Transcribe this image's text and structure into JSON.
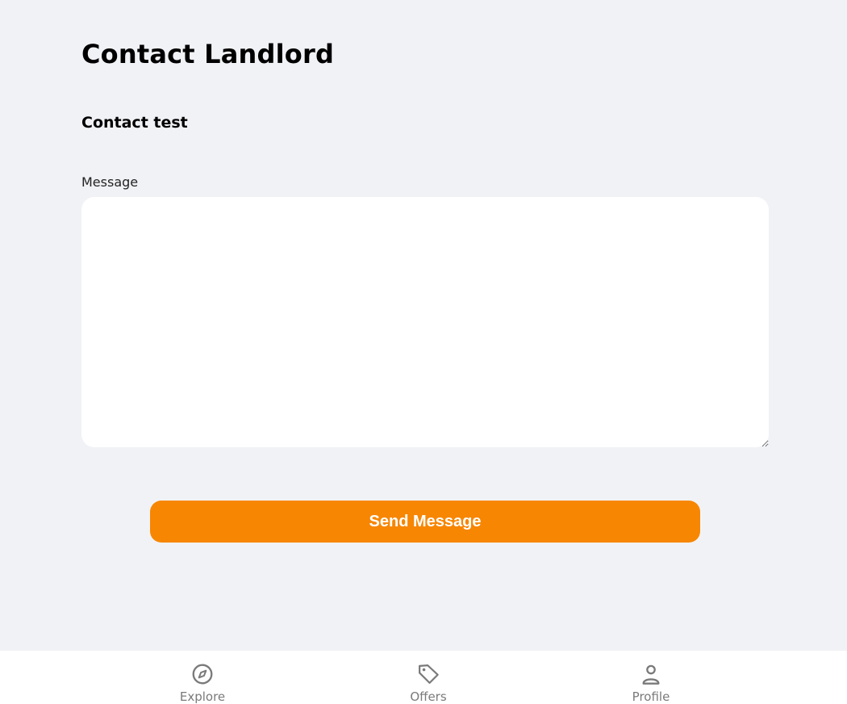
{
  "header": {
    "title": "Contact Landlord"
  },
  "contact": {
    "name": "Contact test"
  },
  "form": {
    "message_label": "Message",
    "message_value": "",
    "send_label": "Send Message"
  },
  "colors": {
    "background": "#f1f2f6",
    "accent": "#f78602",
    "nav_icon": "#7a7a7a"
  },
  "bottom_nav": {
    "items": [
      {
        "label": "Explore",
        "icon": "compass-icon"
      },
      {
        "label": "Offers",
        "icon": "tag-icon"
      },
      {
        "label": "Profile",
        "icon": "user-icon"
      }
    ]
  }
}
